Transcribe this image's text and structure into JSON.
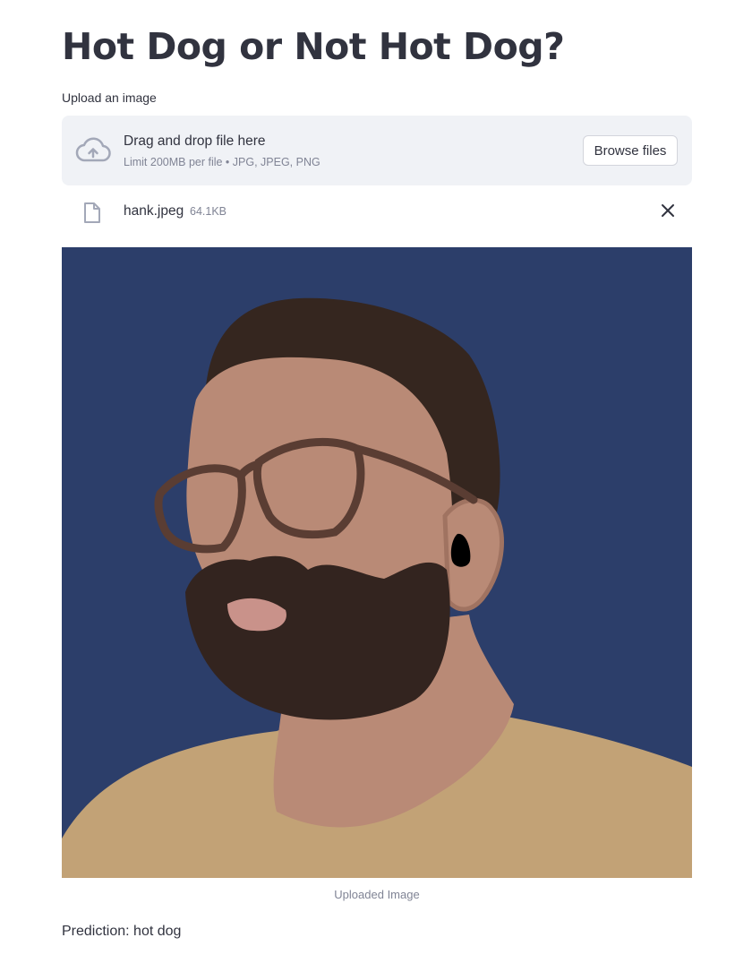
{
  "page": {
    "title": "Hot Dog or Not Hot Dog?"
  },
  "uploader": {
    "label": "Upload an image",
    "dropzone_text": "Drag and drop file here",
    "limit_text": "Limit 200MB per file • JPG, JPEG, PNG",
    "browse_label": "Browse files",
    "icon": "cloud-upload-icon"
  },
  "file": {
    "name": "hank.jpeg",
    "size": "64.1KB",
    "icon": "file-icon",
    "remove_icon": "close-icon"
  },
  "image": {
    "caption": "Uploaded Image",
    "subject": "portrait-illustration"
  },
  "result": {
    "prediction_text": "Prediction: hot dog"
  },
  "colors": {
    "text": "#31333f",
    "muted": "#808495",
    "dropzone_bg": "#f0f2f6",
    "image_bg": "#2c3e6a"
  }
}
